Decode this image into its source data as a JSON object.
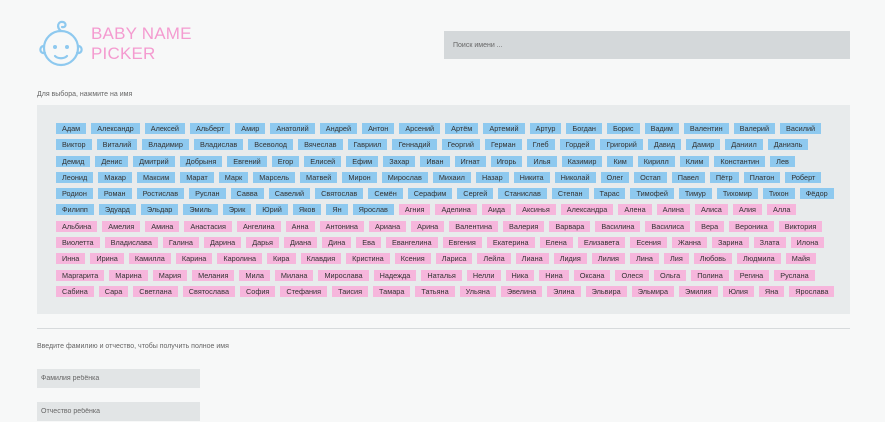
{
  "app": {
    "title_line1": "BABY NAME",
    "title_line2": "PICKER",
    "logo_icon": "baby-face-icon"
  },
  "search": {
    "placeholder": "Поиск имени ..."
  },
  "choose_hint": "Для выбора, нажмите на имя",
  "colors": {
    "boy": "#8ec9ef",
    "girl": "#f6b6dc",
    "brand": "#f49bd0"
  },
  "boys": [
    "Адам",
    "Александр",
    "Алексей",
    "Альберт",
    "Амир",
    "Анатолий",
    "Андрей",
    "Антон",
    "Арсений",
    "Артём",
    "Артемий",
    "Артур",
    "Богдан",
    "Борис",
    "Вадим",
    "Валентин",
    "Валерий",
    "Василий",
    "Виктор",
    "Виталий",
    "Владимир",
    "Владислав",
    "Всеволод",
    "Вячеслав",
    "Гавриил",
    "Геннадий",
    "Георгий",
    "Герман",
    "Глеб",
    "Гордей",
    "Григорий",
    "Давид",
    "Дамир",
    "Даниил",
    "Даниэль",
    "Демид",
    "Денис",
    "Дмитрий",
    "Добрыня",
    "Евгений",
    "Егор",
    "Елисей",
    "Ефим",
    "Захар",
    "Иван",
    "Игнат",
    "Игорь",
    "Илья",
    "Казимир",
    "Ким",
    "Кирилл",
    "Клим",
    "Константин",
    "Лев",
    "Леонид",
    "Макар",
    "Максим",
    "Марат",
    "Марк",
    "Марсель",
    "Матвей",
    "Мирон",
    "Мирослав",
    "Михаил",
    "Назар",
    "Никита",
    "Николай",
    "Олег",
    "Остап",
    "Павел",
    "Пётр",
    "Платон",
    "Роберт",
    "Родион",
    "Роман",
    "Ростислав",
    "Руслан",
    "Савва",
    "Савелий",
    "Святослав",
    "Семён",
    "Серафим",
    "Сергей",
    "Станислав",
    "Степан",
    "Тарас",
    "Тимофей",
    "Тимур",
    "Тихомир",
    "Тихон",
    "Фёдор",
    "Филипп",
    "Эдуард",
    "Эльдар",
    "Эмиль",
    "Эрик",
    "Юрий",
    "Яков",
    "Ян",
    "Ярослав"
  ],
  "girls": [
    "Агния",
    "Аделина",
    "Аида",
    "Аксинья",
    "Александра",
    "Алена",
    "Алина",
    "Алиса",
    "Алия",
    "Алла",
    "Альбина",
    "Амелия",
    "Амина",
    "Анастасия",
    "Ангелина",
    "Анна",
    "Антонина",
    "Ариана",
    "Арина",
    "Валентина",
    "Валерия",
    "Варвара",
    "Василина",
    "Василиса",
    "Вера",
    "Вероника",
    "Виктория",
    "Виолетта",
    "Владислава",
    "Галина",
    "Дарина",
    "Дарья",
    "Диана",
    "Дина",
    "Ева",
    "Евангелина",
    "Евгения",
    "Екатерина",
    "Елена",
    "Елизавета",
    "Есения",
    "Жанна",
    "Зарина",
    "Злата",
    "Илона",
    "Инна",
    "Ирина",
    "Камилла",
    "Карина",
    "Каролина",
    "Кира",
    "Клавдия",
    "Кристина",
    "Ксения",
    "Лариса",
    "Лейла",
    "Лиана",
    "Лидия",
    "Лилия",
    "Лина",
    "Лия",
    "Любовь",
    "Людмила",
    "Майя",
    "Маргарита",
    "Марина",
    "Мария",
    "Мелания",
    "Мила",
    "Милана",
    "Мирослава",
    "Надежда",
    "Наталья",
    "Нелли",
    "Ника",
    "Нина",
    "Оксана",
    "Олеся",
    "Ольга",
    "Полина",
    "Регина",
    "Руслана",
    "Сабина",
    "Сара",
    "Светлана",
    "Святославa",
    "София",
    "Стефания",
    "Таисия",
    "Тамара",
    "Татьяна",
    "Ульяна",
    "Эвелина",
    "Элина",
    "Эльвира",
    "Эльмира",
    "Эмилия",
    "Юлия",
    "Яна",
    "Ярослава"
  ],
  "patronymic_hint": "Введите фамилию и отчество, чтобы получить полное имя",
  "surname": {
    "placeholder": "Фамилия ребёнка",
    "value": ""
  },
  "patronymic": {
    "placeholder": "Отчество ребёнка",
    "value": ""
  }
}
